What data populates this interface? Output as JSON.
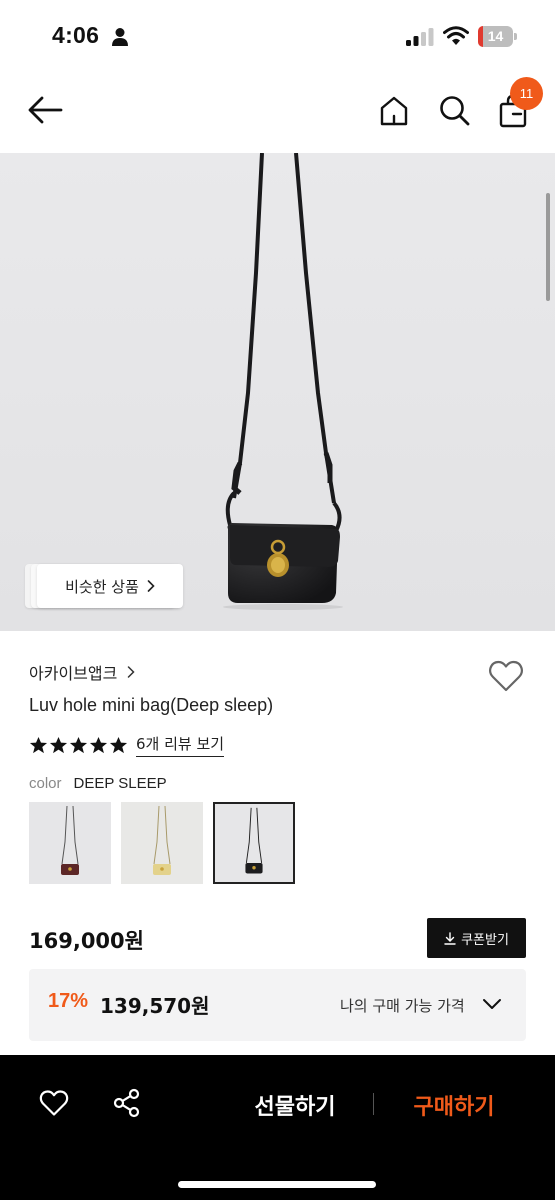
{
  "status_bar": {
    "time": "4:06",
    "battery": "14",
    "battery_level": 0.14,
    "icons": [
      "person-icon",
      "signal-icon",
      "wifi-icon",
      "battery-icon"
    ]
  },
  "nav": {
    "cart_badge": "11",
    "icons": [
      "back-arrow-icon",
      "home-icon",
      "search-icon",
      "shopping-bag-icon"
    ]
  },
  "hero": {
    "similar_label": "비슷한 상품"
  },
  "product": {
    "brand": "아카이브앱크",
    "title": "Luv hole mini bag(Deep sleep)",
    "rating_stars": 5,
    "review_link": "6개 리뷰 보기",
    "color_label": "color",
    "color_value": "DEEP SLEEP",
    "color_options": [
      {
        "name": "burgundy",
        "swatch": "#6a2a2a",
        "selected": false
      },
      {
        "name": "butter",
        "swatch": "#e6d48e",
        "selected": false
      },
      {
        "name": "deep-sleep",
        "swatch": "#1d1d1f",
        "selected": true
      }
    ]
  },
  "price": {
    "original": "169,000원",
    "coupon_label": "쿠폰받기",
    "discount": "17%",
    "sale": "139,570원",
    "my_price_label": "나의 구매 가능 가격"
  },
  "bottom_bar": {
    "gift_label": "선물하기",
    "buy_label": "구매하기",
    "icons": [
      "heart-icon",
      "share-icon"
    ]
  },
  "colors": {
    "accent": "#f05a1a",
    "dark": "#111111",
    "image_bg": "#e6e6e8"
  }
}
